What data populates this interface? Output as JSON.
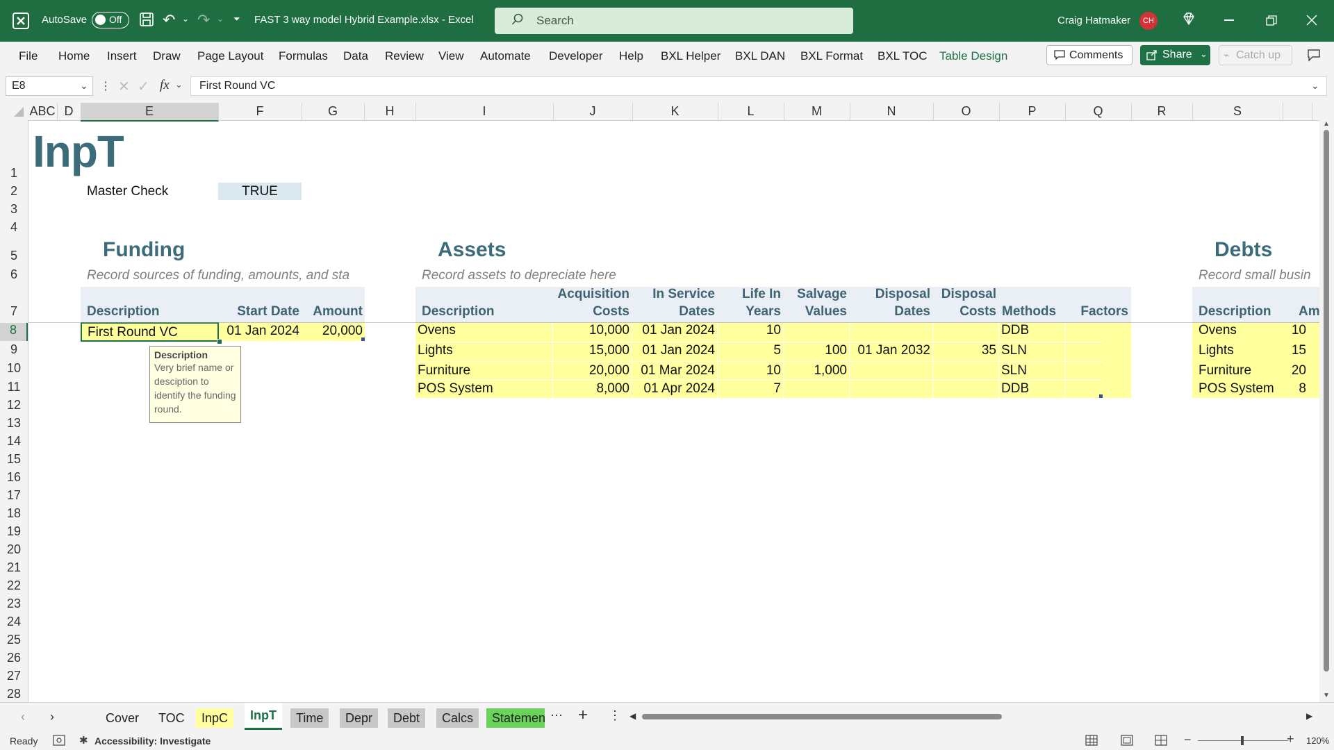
{
  "titlebar": {
    "autosave_label": "AutoSave",
    "autosave_state": "Off",
    "filename": "FAST 3 way model Hybrid Example.xlsx  -  Excel",
    "search_placeholder": "Search",
    "user_name": "Craig Hatmaker",
    "user_initials": "CH"
  },
  "ribbon": {
    "tabs": [
      "File",
      "Home",
      "Insert",
      "Draw",
      "Page Layout",
      "Formulas",
      "Data",
      "Review",
      "View",
      "Automate",
      "Developer",
      "Help",
      "BXL Helper",
      "BXL DAN",
      "BXL Format",
      "BXL TOC",
      "Table Design"
    ],
    "comments_label": "Comments",
    "share_label": "Share",
    "catchup_label": "Catch up"
  },
  "formula_bar": {
    "name_box": "E8",
    "formula": "First Round VC"
  },
  "sheet": {
    "columns": [
      "ABC",
      "D",
      "E",
      "F",
      "G",
      "H",
      "I",
      "J",
      "K",
      "L",
      "M",
      "N",
      "O",
      "P",
      "Q",
      "R",
      "S"
    ],
    "rows": [
      "1",
      "2",
      "3",
      "4",
      "5",
      "6",
      "7",
      "8",
      "9",
      "10",
      "11",
      "12",
      "13",
      "14",
      "15",
      "16",
      "17",
      "18",
      "19",
      "20",
      "21",
      "22",
      "23",
      "24",
      "25",
      "26",
      "27",
      "28"
    ],
    "title": "InpT",
    "master_check_label": "Master Check",
    "master_check_value": "TRUE",
    "funding": {
      "title": "Funding",
      "note": "Record sources of funding, amounts, and sta",
      "headers": [
        "Description",
        "Start Date",
        "Amount"
      ],
      "rows": [
        [
          "First Round VC",
          "01 Jan 2024",
          "20,000"
        ]
      ],
      "tooltip_title": "Description",
      "tooltip_body": "Very brief name or desciption to identify the funding round."
    },
    "assets": {
      "title": "Assets",
      "note": "Record assets to depreciate here",
      "headers": [
        [
          "",
          "Description"
        ],
        [
          "Acquisition",
          "Costs"
        ],
        [
          "In Service",
          "Dates"
        ],
        [
          "Life In",
          "Years"
        ],
        [
          "Salvage",
          "Values"
        ],
        [
          "Disposal",
          "Dates"
        ],
        [
          "Disposal",
          "Costs"
        ],
        [
          "",
          "Methods"
        ],
        [
          "",
          "Factors"
        ]
      ],
      "rows": [
        [
          "Ovens",
          "10,000",
          "01 Jan 2024",
          "10",
          "",
          "",
          "",
          "DDB",
          ""
        ],
        [
          "Lights",
          "15,000",
          "01 Jan 2024",
          "5",
          "100",
          "01 Jan 2032",
          "35",
          "SLN",
          ""
        ],
        [
          "Furniture",
          "20,000",
          "01 Mar 2024",
          "10",
          "1,000",
          "",
          "",
          "SLN",
          ""
        ],
        [
          "POS System",
          "8,000",
          "01 Apr 2024",
          "7",
          "",
          "",
          "",
          "DDB",
          ""
        ]
      ]
    },
    "debts": {
      "title": "Debts",
      "note": "Record small busin",
      "headers": [
        "Description",
        "Am"
      ],
      "rows": [
        [
          "Ovens",
          "10"
        ],
        [
          "Lights",
          "15"
        ],
        [
          "Furniture",
          "20"
        ],
        [
          "POS System",
          "8"
        ]
      ]
    }
  },
  "sheet_tabs": [
    {
      "name": "Cover",
      "color": ""
    },
    {
      "name": "TOC",
      "color": ""
    },
    {
      "name": "InpC",
      "color": "#ffff9e"
    },
    {
      "name": "InpT",
      "color": "#ffffff"
    },
    {
      "name": "Time",
      "color": "#c8c8c8"
    },
    {
      "name": "Depr",
      "color": "#c8c8c8"
    },
    {
      "name": "Debt",
      "color": "#c8c8c8"
    },
    {
      "name": "Calcs",
      "color": "#c8c8c8"
    },
    {
      "name": "Statemen",
      "color": "#6ad35a"
    }
  ],
  "status": {
    "ready": "Ready",
    "accessibility": "Accessibility: Investigate",
    "zoom": "120%"
  },
  "colors": {
    "title_bar": "#1e6e42",
    "input_fill": "#ffff9e",
    "header_text": "#3e6372"
  }
}
